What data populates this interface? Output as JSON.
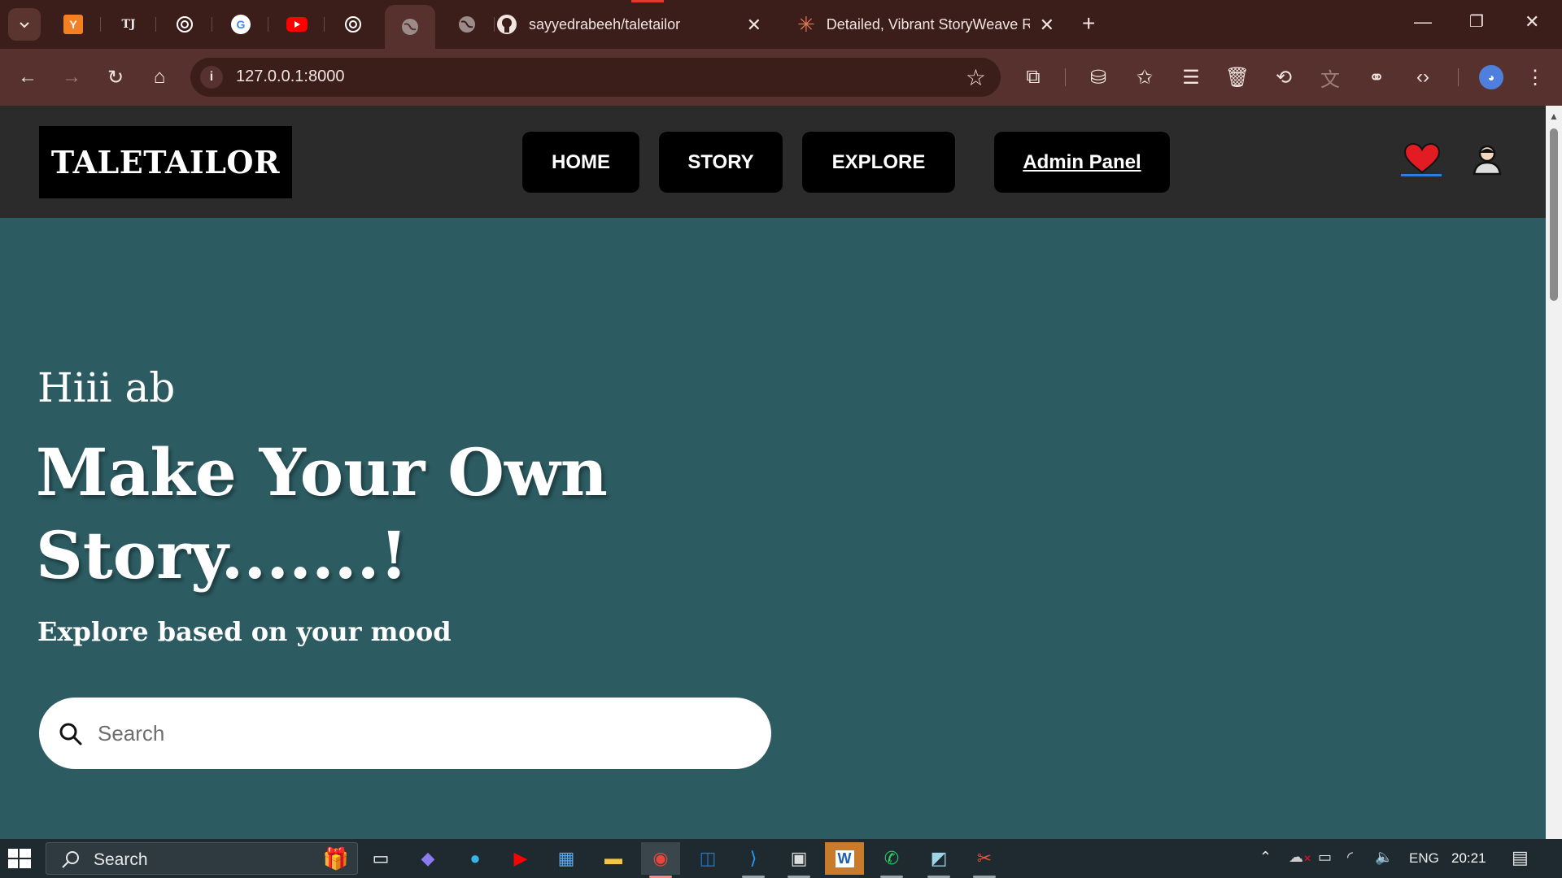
{
  "browser": {
    "tabs": [
      {
        "label": "Y",
        "icon": "y-icon",
        "color": "#f48024"
      },
      {
        "label": "TJ",
        "icon": "tj-icon",
        "color": "#d22"
      },
      {
        "icon": "openai-icon"
      },
      {
        "label": "G",
        "icon": "google-icon"
      },
      {
        "icon": "youtube-icon",
        "color": "#ff0000"
      },
      {
        "icon": "openai-icon"
      },
      {
        "icon": "globe-icon",
        "active": true
      },
      {
        "icon": "globe-icon"
      },
      {
        "title": "sayyedrabeeh/taletailor",
        "icon": "github-icon"
      },
      {
        "title": "Detailed, Vibrant StoryWeave R",
        "icon": "spark-icon",
        "color": "#d97757"
      }
    ],
    "url": "127.0.0.1:8000"
  },
  "site": {
    "logo": "TALETAILOR",
    "nav": {
      "home": "HOME",
      "story": "STORY",
      "explore": "EXPLORE",
      "admin": "Admin Panel"
    },
    "hero": {
      "greeting": "Hiii ab",
      "headline": "Make Your Own Story.......!",
      "tagline": "Explore based on your mood"
    },
    "search": {
      "placeholder": "Search",
      "value": ""
    },
    "colors": {
      "hero_bg": "#2c5c62",
      "nav_bg": "#2b2b2b",
      "heart": "#e31b23"
    }
  },
  "taskbar": {
    "search_label": "Search",
    "language": "ENG",
    "time": "20:21"
  }
}
